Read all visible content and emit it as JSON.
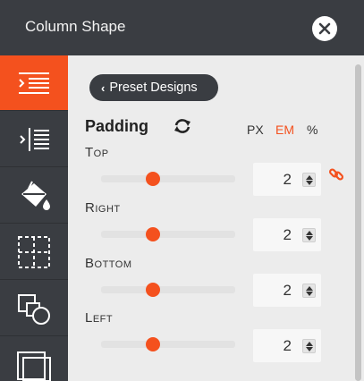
{
  "header": {
    "title": "Column Shape"
  },
  "sidebar": {
    "items": [
      {
        "icon": "padding-icon",
        "active": true
      },
      {
        "icon": "margin-icon",
        "active": false
      },
      {
        "icon": "paint-bucket-icon",
        "active": false
      },
      {
        "icon": "grid-border-icon",
        "active": false
      },
      {
        "icon": "shapes-icon",
        "active": false
      },
      {
        "icon": "layers-icon",
        "active": false
      }
    ]
  },
  "preset": {
    "label": "Preset Designs"
  },
  "padding": {
    "title": "Padding",
    "units": [
      {
        "label": "PX",
        "active": false
      },
      {
        "label": "EM",
        "active": true
      },
      {
        "label": "%",
        "active": false
      }
    ],
    "rows": [
      {
        "first": "T",
        "rest": "OP",
        "value": "2"
      },
      {
        "first": "R",
        "rest": "IGHT",
        "value": "2"
      },
      {
        "first": "B",
        "rest": "OTTOM",
        "value": "2"
      },
      {
        "first": "L",
        "rest": "EFT",
        "value": "2"
      }
    ]
  },
  "colors": {
    "accent": "#f4511e",
    "dark": "#3a3d42"
  }
}
